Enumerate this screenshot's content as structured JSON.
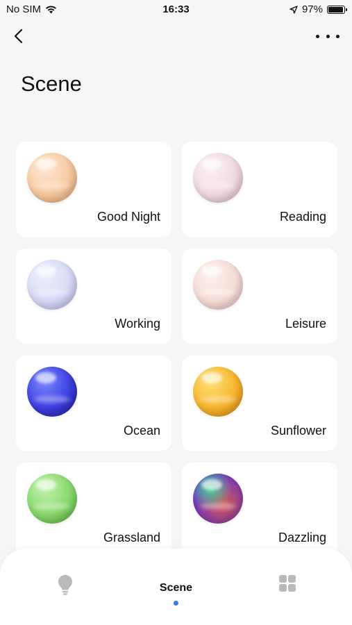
{
  "status_bar": {
    "carrier": "No SIM",
    "time": "16:33",
    "battery_percent": "97%",
    "battery_level": 0.97
  },
  "header": {
    "title": "Scene"
  },
  "scenes": [
    {
      "label": "Good Night",
      "color_main": "#f7c9a0",
      "color_light": "#fde8d4",
      "color_dark": "#e9a975"
    },
    {
      "label": "Reading",
      "color_main": "#f2d9e1",
      "color_light": "#fbeff3",
      "color_dark": "#e2c0cc"
    },
    {
      "label": "Working",
      "color_main": "#d7d9f6",
      "color_light": "#eef0fd",
      "color_dark": "#b8bcee"
    },
    {
      "label": "Leisure",
      "color_main": "#f6dcd6",
      "color_light": "#fcefec",
      "color_dark": "#e9c3ba"
    },
    {
      "label": "Ocean",
      "color_main": "#3d3fe0",
      "color_light": "#7a86ff",
      "color_dark": "#1e1c9a"
    },
    {
      "label": "Sunflower",
      "color_main": "#f7b52c",
      "color_light": "#fde07a",
      "color_dark": "#e08a12"
    },
    {
      "label": "Grassland",
      "color_main": "#88d86c",
      "color_light": "#c3f1ad",
      "color_dark": "#58b63e"
    },
    {
      "label": "Dazzling",
      "color_main": "#d8574f",
      "color_light": "#3fd6a0",
      "color_dark": "#6a35c8"
    }
  ],
  "tab_bar": {
    "active_label": "Scene",
    "accent_color": "#3a7bea"
  },
  "icons": {
    "back": "chevron-left-icon",
    "more": "more-icon",
    "wifi": "wifi-icon",
    "location": "location-arrow-icon",
    "battery": "battery-icon",
    "home_tab": "lightbulb-icon",
    "more_tab": "grid-icon"
  }
}
